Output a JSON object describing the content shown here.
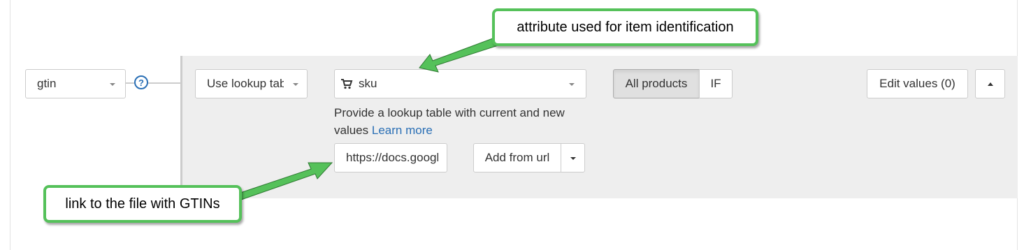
{
  "field": {
    "value": "gtin"
  },
  "help": {
    "symbol": "?"
  },
  "method": {
    "value": "Use lookup table"
  },
  "attribute": {
    "value": "sku",
    "icon": "shopping-cart-icon"
  },
  "lookup_help": {
    "text": "Provide a lookup table with current and new values",
    "link": "Learn more"
  },
  "url_input": {
    "value": "https://docs.google.com/spreadsheets"
  },
  "add_from_url": {
    "label": "Add from url"
  },
  "scope": {
    "all_label": "All products",
    "if_label": "IF"
  },
  "edit_values": {
    "label": "Edit values (0)"
  },
  "callouts": {
    "attribute": "attribute used for item identification",
    "link": "link to the file with GTINs"
  },
  "colors": {
    "callout_border": "#55c15a",
    "link": "#2a6fb5",
    "panel": "#eeeeee"
  }
}
